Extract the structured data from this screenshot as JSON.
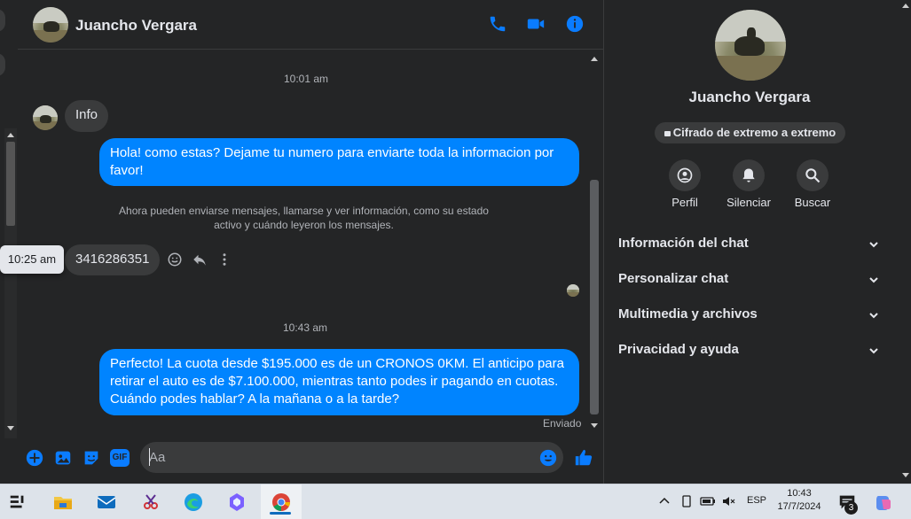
{
  "header": {
    "contact_name": "Juancho Vergara",
    "icons": [
      "phone-icon",
      "video-call-icon",
      "info-icon"
    ]
  },
  "messages": {
    "timestamp_1": "10:01 am",
    "incoming_1": "Info",
    "outgoing_1": "Hola! como estas? Dejame tu numero para enviarte toda la informacion por favor!",
    "system_note": "Ahora pueden enviarse mensajes, llamarse y ver información, como su estado activo y cuándo leyeron los mensajes.",
    "tooltip_time": "10:25 am",
    "incoming_2": "3416286351",
    "timestamp_2": "10:43 am",
    "outgoing_2": "Perfecto! La cuota desde $195.000 es de un CRONOS 0KM. El anticipo para retirar el auto es de $7.100.000, mientras tanto podes ir pagando en cuotas. Cuándo podes hablar? A la mañana o a la tarde?",
    "status": "Enviado"
  },
  "composer": {
    "placeholder": "Aa",
    "gif_label": "GIF"
  },
  "right_panel": {
    "name": "Juancho Vergara",
    "encryption_badge": "Cifrado de extremo a extremo",
    "actions": [
      {
        "label": "Perfil",
        "icon": "profile-icon"
      },
      {
        "label": "Silenciar",
        "icon": "bell-icon"
      },
      {
        "label": "Buscar",
        "icon": "search-icon"
      }
    ],
    "sections": [
      {
        "label": "Información del chat"
      },
      {
        "label": "Personalizar chat"
      },
      {
        "label": "Multimedia y archivos"
      },
      {
        "label": "Privacidad y ayuda"
      }
    ]
  },
  "taskbar": {
    "language": "ESP",
    "time": "10:43",
    "date": "17/7/2024",
    "notification_count": "3"
  },
  "colors": {
    "accent": "#0084ff",
    "background": "#242526",
    "bubble_in": "#3a3b3c"
  }
}
